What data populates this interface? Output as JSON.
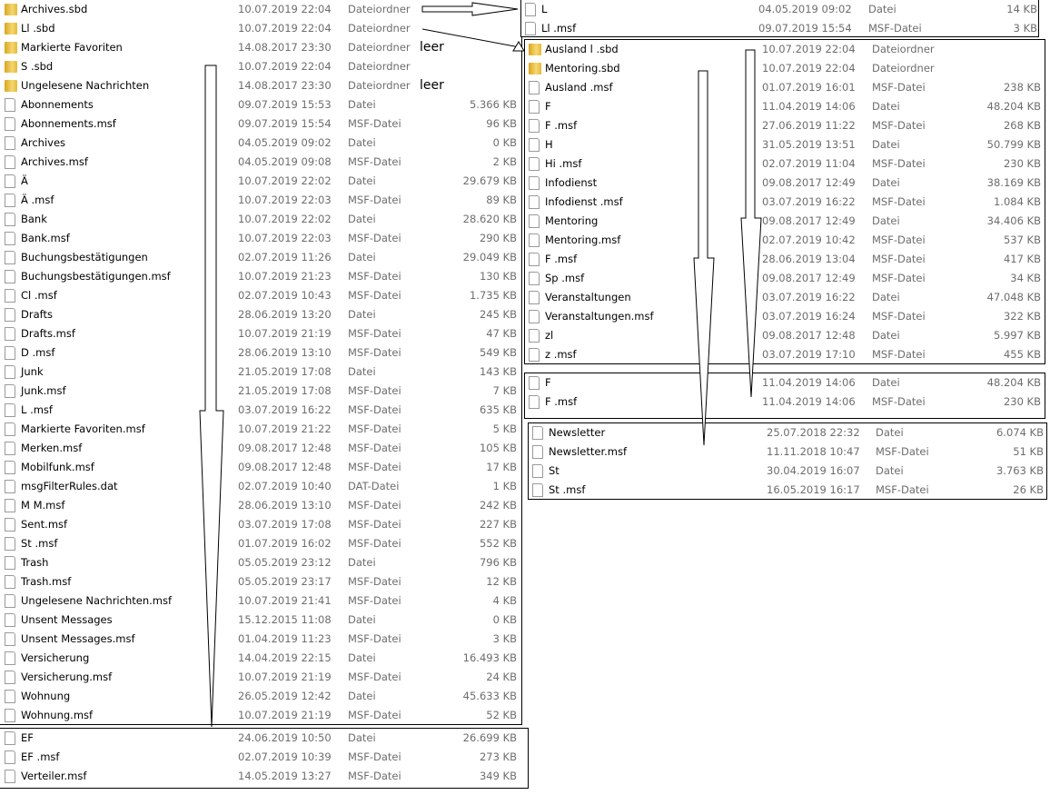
{
  "left_panel": [
    {
      "icon": "folder",
      "name": "Archives.sbd",
      "date": "10.07.2019 22:04",
      "type": "Dateiordner",
      "size": ""
    },
    {
      "icon": "folder",
      "name": "Ll     .sbd",
      "date": "10.07.2019 22:04",
      "type": "Dateiordner",
      "size": ""
    },
    {
      "icon": "folder",
      "name": "Markierte Favoriten",
      "date": "14.08.2017 23:30",
      "type": "Dateiordner",
      "size": ""
    },
    {
      "icon": "folder",
      "name": "S            .sbd",
      "date": "10.07.2019 22:04",
      "type": "Dateiordner",
      "size": ""
    },
    {
      "icon": "folder",
      "name": "Ungelesene Nachrichten",
      "date": "14.08.2017 23:30",
      "type": "Dateiordner",
      "size": ""
    },
    {
      "icon": "file",
      "name": "Abonnements",
      "date": "09.07.2019 15:53",
      "type": "Datei",
      "size": "5.366 KB"
    },
    {
      "icon": "file",
      "name": "Abonnements.msf",
      "date": "09.07.2019 15:54",
      "type": "MSF-Datei",
      "size": "96 KB"
    },
    {
      "icon": "file",
      "name": "Archives",
      "date": "04.05.2019 09:02",
      "type": "Datei",
      "size": "0 KB"
    },
    {
      "icon": "file",
      "name": "Archives.msf",
      "date": "04.05.2019 09:08",
      "type": "MSF-Datei",
      "size": "2 KB"
    },
    {
      "icon": "file",
      "name": "Ä",
      "date": "10.07.2019 22:02",
      "type": "Datei",
      "size": "29.679 KB"
    },
    {
      "icon": "file",
      "name": "Ä                         .msf",
      "date": "10.07.2019 22:03",
      "type": "MSF-Datei",
      "size": "89 KB"
    },
    {
      "icon": "file",
      "name": "Bank",
      "date": "10.07.2019 22:02",
      "type": "Datei",
      "size": "28.620 KB"
    },
    {
      "icon": "file",
      "name": "Bank.msf",
      "date": "10.07.2019 22:03",
      "type": "MSF-Datei",
      "size": "290 KB"
    },
    {
      "icon": "file",
      "name": "Buchungsbestätigungen",
      "date": "02.07.2019 11:26",
      "type": "Datei",
      "size": "29.049 KB"
    },
    {
      "icon": "file",
      "name": "Buchungsbestätigungen.msf",
      "date": "10.07.2019 21:23",
      "type": "MSF-Datei",
      "size": "130 KB"
    },
    {
      "icon": "file",
      "name": "Cl     .msf",
      "date": "02.07.2019 10:43",
      "type": "MSF-Datei",
      "size": "1.735 KB"
    },
    {
      "icon": "file",
      "name": "Drafts",
      "date": "28.06.2019 13:20",
      "type": "Datei",
      "size": "245 KB"
    },
    {
      "icon": "file",
      "name": "Drafts.msf",
      "date": "10.07.2019 21:19",
      "type": "MSF-Datei",
      "size": "47 KB"
    },
    {
      "icon": "file",
      "name": "D               .msf",
      "date": "28.06.2019 13:10",
      "type": "MSF-Datei",
      "size": "549 KB"
    },
    {
      "icon": "file",
      "name": "Junk",
      "date": "21.05.2019 17:08",
      "type": "Datei",
      "size": "143 KB"
    },
    {
      "icon": "file",
      "name": "Junk.msf",
      "date": "21.05.2019 17:08",
      "type": "MSF-Datei",
      "size": "7 KB"
    },
    {
      "icon": "file",
      "name": "L       .msf",
      "date": "03.07.2019 16:22",
      "type": "MSF-Datei",
      "size": "635 KB"
    },
    {
      "icon": "file",
      "name": "Markierte Favoriten.msf",
      "date": "10.07.2019 21:22",
      "type": "MSF-Datei",
      "size": "5 KB"
    },
    {
      "icon": "file",
      "name": "Merken.msf",
      "date": "09.08.2017 12:48",
      "type": "MSF-Datei",
      "size": "105 KB"
    },
    {
      "icon": "file",
      "name": "Mobilfunk.msf",
      "date": "09.08.2017 12:48",
      "type": "MSF-Datei",
      "size": "17 KB"
    },
    {
      "icon": "file",
      "name": "msgFilterRules.dat",
      "date": "02.07.2019 10:40",
      "type": "DAT-Datei",
      "size": "1 KB"
    },
    {
      "icon": "file",
      "name": "M       M.msf",
      "date": "28.06.2019 13:10",
      "type": "MSF-Datei",
      "size": "242 KB"
    },
    {
      "icon": "file",
      "name": "Sent.msf",
      "date": "03.07.2019 17:08",
      "type": "MSF-Datei",
      "size": "227 KB"
    },
    {
      "icon": "file",
      "name": "St            .msf",
      "date": "01.07.2019 16:02",
      "type": "MSF-Datei",
      "size": "552 KB"
    },
    {
      "icon": "file",
      "name": "Trash",
      "date": "05.05.2019 23:12",
      "type": "Datei",
      "size": "796 KB"
    },
    {
      "icon": "file",
      "name": "Trash.msf",
      "date": "05.05.2019 23:17",
      "type": "MSF-Datei",
      "size": "12 KB"
    },
    {
      "icon": "file",
      "name": "Ungelesene Nachrichten.msf",
      "date": "10.07.2019 21:41",
      "type": "MSF-Datei",
      "size": "4 KB"
    },
    {
      "icon": "file",
      "name": "Unsent Messages",
      "date": "15.12.2015 11:08",
      "type": "Datei",
      "size": "0 KB"
    },
    {
      "icon": "file",
      "name": "Unsent Messages.msf",
      "date": "01.04.2019 11:23",
      "type": "MSF-Datei",
      "size": "3 KB"
    },
    {
      "icon": "file",
      "name": "Versicherung",
      "date": "14.04.2019 22:15",
      "type": "Datei",
      "size": "16.493 KB"
    },
    {
      "icon": "file",
      "name": "Versicherung.msf",
      "date": "10.07.2019 21:19",
      "type": "MSF-Datei",
      "size": "24 KB"
    },
    {
      "icon": "file",
      "name": "Wohnung",
      "date": "26.05.2019 12:42",
      "type": "Datei",
      "size": "45.633 KB"
    },
    {
      "icon": "file",
      "name": "Wohnung.msf",
      "date": "10.07.2019 21:19",
      "type": "MSF-Datei",
      "size": "52 KB"
    }
  ],
  "bottom_left_panel": [
    {
      "icon": "file",
      "name": "EF",
      "date": "24.06.2019 10:50",
      "type": "Datei",
      "size": "26.699 KB"
    },
    {
      "icon": "file",
      "name": "EF          .msf",
      "date": "02.07.2019 10:39",
      "type": "MSF-Datei",
      "size": "273 KB"
    },
    {
      "icon": "file",
      "name": "Verteiler.msf",
      "date": "14.05.2019 13:27",
      "type": "MSF-Datei",
      "size": "349 KB"
    }
  ],
  "archives_panel": [
    {
      "icon": "file",
      "name": "L",
      "date": "04.05.2019 09:02",
      "type": "Datei",
      "size": "14 KB"
    },
    {
      "icon": "file",
      "name": "Ll     .msf",
      "date": "09.07.2019 15:54",
      "type": "MSF-Datei",
      "size": "3 KB"
    }
  ],
  "ll_panel": [
    {
      "icon": "folder",
      "name": "Ausland l                   .sbd",
      "date": "10.07.2019 22:04",
      "type": "Dateiordner",
      "size": ""
    },
    {
      "icon": "folder",
      "name": "Mentoring.sbd",
      "date": "10.07.2019 22:04",
      "type": "Dateiordner",
      "size": ""
    },
    {
      "icon": "file",
      "name": "Ausland                       .msf",
      "date": "01.07.2019 16:01",
      "type": "MSF-Datei",
      "size": "238 KB"
    },
    {
      "icon": "file",
      "name": "F",
      "date": "11.04.2019 14:06",
      "type": "Datei",
      "size": "48.204 KB"
    },
    {
      "icon": "file",
      "name": "F          .msf",
      "date": "27.06.2019 11:22",
      "type": "MSF-Datei",
      "size": "268 KB"
    },
    {
      "icon": "file",
      "name": "H",
      "date": "31.05.2019 13:51",
      "type": "Datei",
      "size": "50.799 KB"
    },
    {
      "icon": "file",
      "name": "Hi                   .msf",
      "date": "02.07.2019 11:04",
      "type": "MSF-Datei",
      "size": "230 KB"
    },
    {
      "icon": "file",
      "name": "Infodienst",
      "date": "09.08.2017 12:49",
      "type": "Datei",
      "size": "38.169 KB"
    },
    {
      "icon": "file",
      "name": "Infodienst          .msf",
      "date": "03.07.2019 16:22",
      "type": "MSF-Datei",
      "size": "1.084 KB"
    },
    {
      "icon": "file",
      "name": "Mentoring",
      "date": "09.08.2017 12:49",
      "type": "Datei",
      "size": "34.406 KB"
    },
    {
      "icon": "file",
      "name": "Mentoring.msf",
      "date": "02.07.2019 10:42",
      "type": "MSF-Datei",
      "size": "537 KB"
    },
    {
      "icon": "file",
      "name": "F  .msf",
      "date": "28.06.2019 13:04",
      "type": "MSF-Datei",
      "size": "417 KB"
    },
    {
      "icon": "file",
      "name": "Sp          .msf",
      "date": "09.08.2017 12:49",
      "type": "MSF-Datei",
      "size": "34 KB"
    },
    {
      "icon": "file",
      "name": "Veranstaltungen",
      "date": "03.07.2019 16:22",
      "type": "Datei",
      "size": "47.048 KB"
    },
    {
      "icon": "file",
      "name": "Veranstaltungen.msf",
      "date": "03.07.2019 16:24",
      "type": "MSF-Datei",
      "size": "322 KB"
    },
    {
      "icon": "file",
      "name": "zl",
      "date": "09.08.2017 12:48",
      "type": "Datei",
      "size": "5.997 KB"
    },
    {
      "icon": "file",
      "name": "z     .msf",
      "date": "03.07.2019 17:10",
      "type": "MSF-Datei",
      "size": "455 KB"
    }
  ],
  "ausland_panel": [
    {
      "icon": "file",
      "name": "F",
      "date": "11.04.2019 14:06",
      "type": "Datei",
      "size": "48.204 KB"
    },
    {
      "icon": "file",
      "name": "F          .msf",
      "date": "11.04.2019 14:06",
      "type": "MSF-Datei",
      "size": "230 KB"
    }
  ],
  "mentoring_panel": [
    {
      "icon": "file",
      "name": "Newsletter",
      "date": "25.07.2018 22:32",
      "type": "Datei",
      "size": "6.074 KB"
    },
    {
      "icon": "file",
      "name": "Newsletter.msf",
      "date": "11.11.2018 10:47",
      "type": "MSF-Datei",
      "size": "51 KB"
    },
    {
      "icon": "file",
      "name": "St",
      "date": "30.04.2019 16:07",
      "type": "Datei",
      "size": "3.763 KB"
    },
    {
      "icon": "file",
      "name": "St           .msf",
      "date": "16.05.2019 16:17",
      "type": "MSF-Datei",
      "size": "26 KB"
    }
  ],
  "notes": {
    "empty_1": "leer",
    "empty_2": "leer"
  }
}
